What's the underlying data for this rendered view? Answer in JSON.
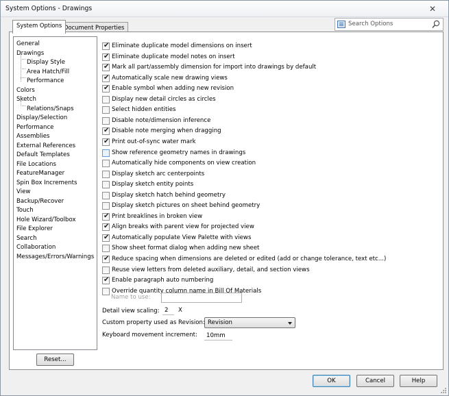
{
  "window": {
    "title": "System Options - Drawings",
    "close_symbol": "✕"
  },
  "tabs": [
    {
      "label": "System Options",
      "active": true
    },
    {
      "label": "Document Properties",
      "active": false
    }
  ],
  "search": {
    "placeholder": "Search Options"
  },
  "nav": {
    "items": [
      {
        "label": "General",
        "indent": 0
      },
      {
        "label": "Drawings",
        "indent": 0
      },
      {
        "label": "Display Style",
        "indent": 1
      },
      {
        "label": "Area Hatch/Fill",
        "indent": 1
      },
      {
        "label": "Performance",
        "indent": 1
      },
      {
        "label": "Colors",
        "indent": 0
      },
      {
        "label": "Sketch",
        "indent": 0
      },
      {
        "label": "Relations/Snaps",
        "indent": 1
      },
      {
        "label": "Display/Selection",
        "indent": 0
      },
      {
        "label": "Performance",
        "indent": 0
      },
      {
        "label": "Assemblies",
        "indent": 0
      },
      {
        "label": "External References",
        "indent": 0
      },
      {
        "label": "Default Templates",
        "indent": 0
      },
      {
        "label": "File Locations",
        "indent": 0
      },
      {
        "label": "FeatureManager",
        "indent": 0
      },
      {
        "label": "Spin Box Increments",
        "indent": 0
      },
      {
        "label": "View",
        "indent": 0
      },
      {
        "label": "Backup/Recover",
        "indent": 0
      },
      {
        "label": "Touch",
        "indent": 0
      },
      {
        "label": "Hole Wizard/Toolbox",
        "indent": 0
      },
      {
        "label": "File Explorer",
        "indent": 0
      },
      {
        "label": "Search",
        "indent": 0
      },
      {
        "label": "Collaboration",
        "indent": 0
      },
      {
        "label": "Messages/Errors/Warnings",
        "indent": 0
      }
    ],
    "reset_label": "Reset..."
  },
  "options": [
    {
      "label": "Eliminate duplicate model dimensions on insert",
      "checked": true
    },
    {
      "label": "Eliminate duplicate model notes on insert",
      "checked": true
    },
    {
      "label": "Mark all part/assembly dimension for import into drawings by default",
      "checked": true
    },
    {
      "label": "Automatically scale new drawing views",
      "checked": true
    },
    {
      "label": "Enable symbol when adding new revision",
      "checked": true
    },
    {
      "label": "Display new detail circles as circles",
      "checked": false
    },
    {
      "label": "Select hidden entities",
      "checked": false
    },
    {
      "label": "Disable note/dimension inference",
      "checked": false
    },
    {
      "label": "Disable note merging when dragging",
      "checked": true
    },
    {
      "label": "Print out-of-sync water mark",
      "checked": true
    },
    {
      "label": "Show reference geometry names in drawings",
      "checked": false,
      "hover": true
    },
    {
      "label": "Automatically hide components on view creation",
      "checked": false
    },
    {
      "label": "Display sketch arc centerpoints",
      "checked": false
    },
    {
      "label": "Display sketch entity points",
      "checked": false
    },
    {
      "label": "Display sketch hatch behind geometry",
      "checked": false
    },
    {
      "label": "Display sketch pictures on sheet behind geometry",
      "checked": false
    },
    {
      "label": "Print breaklines in broken view",
      "checked": true
    },
    {
      "label": "Align breaks with parent view for projected view",
      "checked": true
    },
    {
      "label": "Automatically populate View Palette with views",
      "checked": true
    },
    {
      "label": "Show sheet format dialog when adding new sheet",
      "checked": false
    },
    {
      "label": "Reduce spacing when dimensions are deleted or edited (add or change tolerance, text etc...)",
      "checked": true
    },
    {
      "label": "Reuse view letters from deleted auxiliary, detail, and section views",
      "checked": false
    },
    {
      "label": "Enable paragraph auto numbering",
      "checked": true
    },
    {
      "label": "Override quantity column name in Bill Of Materials",
      "checked": false
    }
  ],
  "fields": {
    "name_to_use_label": "Name to use:",
    "name_to_use_value": "",
    "detail_scaling_label": "Detail view scaling:",
    "detail_scaling_value": "2",
    "detail_scaling_unit": "X",
    "custom_property_label": "Custom property used as Revision:",
    "custom_property_value": "Revision",
    "keyboard_increment_label": "Keyboard movement increment:",
    "keyboard_increment_value": "10mm"
  },
  "buttons": {
    "ok": "OK",
    "cancel": "Cancel",
    "help": "Help"
  },
  "colors": {
    "panel_bg": "#f0f0f0",
    "accent": "#4677b4",
    "border": "#8d8d8d"
  }
}
